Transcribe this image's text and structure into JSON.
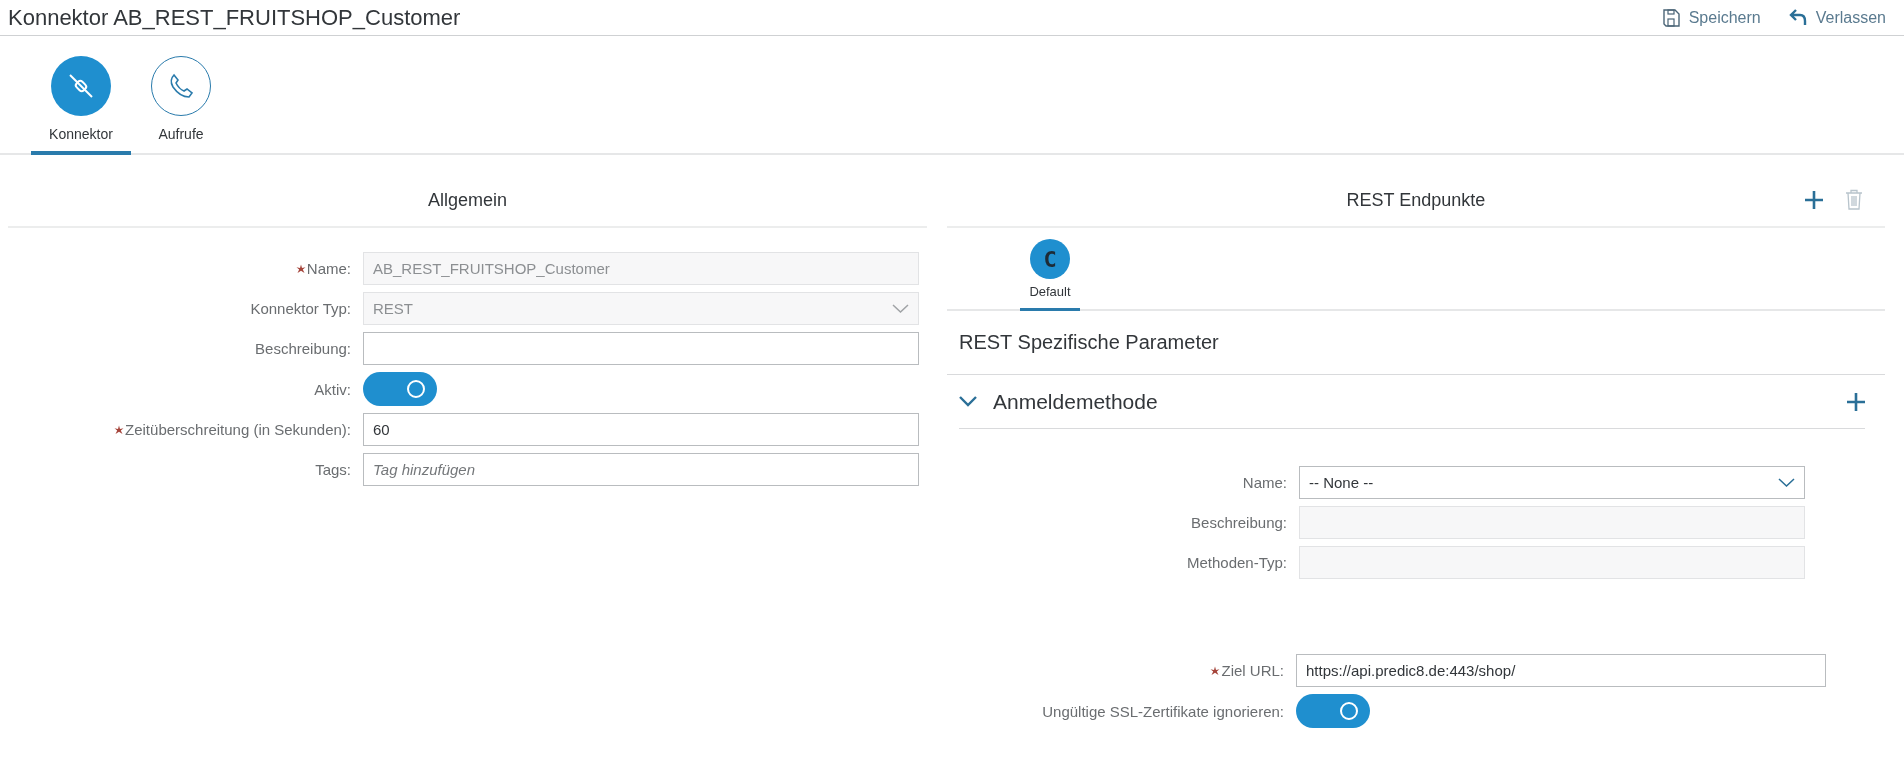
{
  "header": {
    "title": "Konnektor AB_REST_FRUITSHOP_Customer",
    "actions": [
      {
        "label": "Speichern",
        "kind": "save"
      },
      {
        "label": "Verlassen",
        "kind": "exit"
      }
    ]
  },
  "nav_tabs": [
    {
      "label": "Konnektor",
      "kind": "connector",
      "selected": true
    },
    {
      "label": "Aufrufe",
      "kind": "phone",
      "selected": false
    }
  ],
  "general": {
    "title": "Allgemein",
    "fields": [
      {
        "label": "Name:",
        "kind": "text",
        "required": true,
        "disabled": true,
        "value": "AB_REST_FRUITSHOP_Customer"
      },
      {
        "label": "Konnektor Typ:",
        "kind": "select",
        "required": false,
        "disabled": true,
        "value": "REST"
      },
      {
        "label": "Beschreibung:",
        "kind": "text",
        "required": false,
        "disabled": false
      },
      {
        "label": "Aktiv:",
        "kind": "toggle",
        "required": false,
        "on": true
      },
      {
        "label": "Zeitüberschreitung (in Sekunden):",
        "kind": "text",
        "required": true,
        "disabled": false,
        "value": "60"
      },
      {
        "label": "Tags:",
        "kind": "text",
        "required": false,
        "disabled": false,
        "placeholder": "Tag hinzufügen"
      }
    ]
  },
  "endpoints": {
    "title": "REST Endpunkte",
    "delete_disabled": true,
    "tabs": [
      {
        "label": "Default",
        "letter": "C",
        "selected": true
      }
    ],
    "section_title": "REST Spezifische Parameter",
    "auth": {
      "title": "Anmeldemethode",
      "expanded": true,
      "fields": [
        {
          "label": "Name:",
          "kind": "select",
          "required": false,
          "disabled": false,
          "value": "-- None --"
        },
        {
          "label": "Beschreibung:",
          "kind": "text",
          "required": false,
          "disabled": true
        },
        {
          "label": "Methoden-Typ:",
          "kind": "text",
          "required": false,
          "disabled": true
        }
      ]
    },
    "fields": [
      {
        "label": "Ziel URL:",
        "kind": "text",
        "required": true,
        "disabled": false,
        "value": "https://api.predic8.de:443/shop/"
      },
      {
        "label": "Ungültige SSL-Zertifikate ignorieren:",
        "kind": "toggle",
        "required": false,
        "on": true
      }
    ]
  }
}
